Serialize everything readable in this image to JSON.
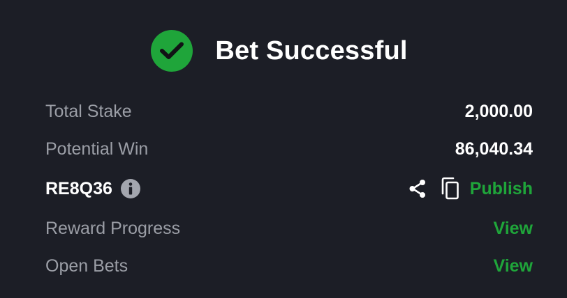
{
  "header": {
    "title": "Bet Successful",
    "status_icon": "check-circle-icon"
  },
  "summary": {
    "total_stake_label": "Total Stake",
    "total_stake_value": "2,000.00",
    "potential_win_label": "Potential Win",
    "potential_win_value": "86,040.34"
  },
  "booking": {
    "code": "RE8Q36",
    "info_icon": "info-icon",
    "share_icon": "share-icon",
    "copy_icon": "copy-icon",
    "publish_label": "Publish"
  },
  "links": {
    "reward_progress_label": "Reward Progress",
    "reward_progress_action": "View",
    "open_bets_label": "Open Bets",
    "open_bets_action": "View"
  },
  "colors": {
    "background": "#1c1e26",
    "accent": "#1fa53a",
    "muted_text": "#9b9ea6",
    "text": "#ffffff"
  }
}
